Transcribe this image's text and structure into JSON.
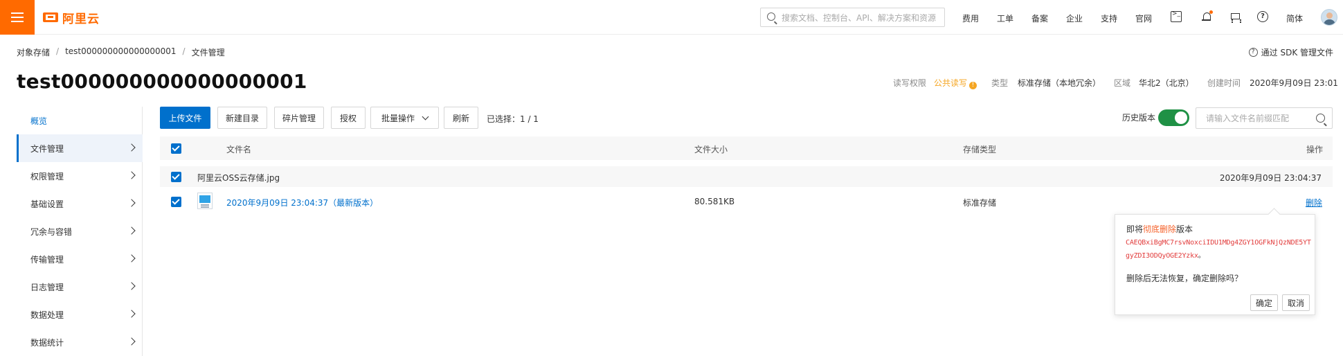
{
  "brand": {
    "color": "#ff6a00",
    "logo_text": "阿里云"
  },
  "topbar": {
    "search_placeholder": "搜索文档、控制台、API、解决方案和资源",
    "nav": [
      "费用",
      "工单",
      "备案",
      "企业",
      "支持",
      "官网"
    ],
    "lang": "简体"
  },
  "breadcrumb": [
    "对象存储",
    "test000000000000000001",
    "文件管理"
  ],
  "sdk_link": "通过 SDK 管理文件",
  "bucket": {
    "name": "test000000000000000001",
    "acl_label": "读写权限",
    "acl_value": "公共读写",
    "type_label": "类型",
    "type_value": "标准存储（本地冗余）",
    "region_label": "区域",
    "region_value": "华北2（北京）",
    "created_label": "创建时间",
    "created_value": "2020年9月09日 23:01"
  },
  "sidebar": [
    {
      "label": "概览"
    },
    {
      "label": "文件管理"
    },
    {
      "label": "权限管理"
    },
    {
      "label": "基础设置"
    },
    {
      "label": "冗余与容错"
    },
    {
      "label": "传输管理"
    },
    {
      "label": "日志管理"
    },
    {
      "label": "数据处理"
    },
    {
      "label": "数据统计"
    }
  ],
  "toolbar": {
    "upload": "上传文件",
    "new_dir": "新建目录",
    "fragments": "碎片管理",
    "authorize": "授权",
    "batch": "批量操作",
    "refresh": "刷新",
    "selected": "已选择：1 / 1",
    "history": "历史版本",
    "search_placeholder": "请输入文件名前缀匹配"
  },
  "table": {
    "headers": [
      "文件名",
      "文件大小",
      "存储类型",
      "操作"
    ],
    "group": {
      "name": "阿里云OSS云存储.jpg",
      "time": "2020年9月09日 23:04:37"
    },
    "row": {
      "version": "2020年9月09日 23:04:37（最新版本）",
      "size": "80.581KB",
      "storage": "标准存储",
      "action": "删除"
    }
  },
  "popover": {
    "prefix": "即将",
    "danger": "彻底删除",
    "suffix": "版本",
    "version_id": "CAEQBxiBgMC7rsvNoxciIDU1MDg4ZGY1OGFkNjQzNDE5YTgyZDI3ODQyOGE2Yzkx",
    "version_end": "。",
    "warning": "删除后无法恢复，确定删除吗？",
    "confirm": "确定",
    "cancel": "取消"
  }
}
